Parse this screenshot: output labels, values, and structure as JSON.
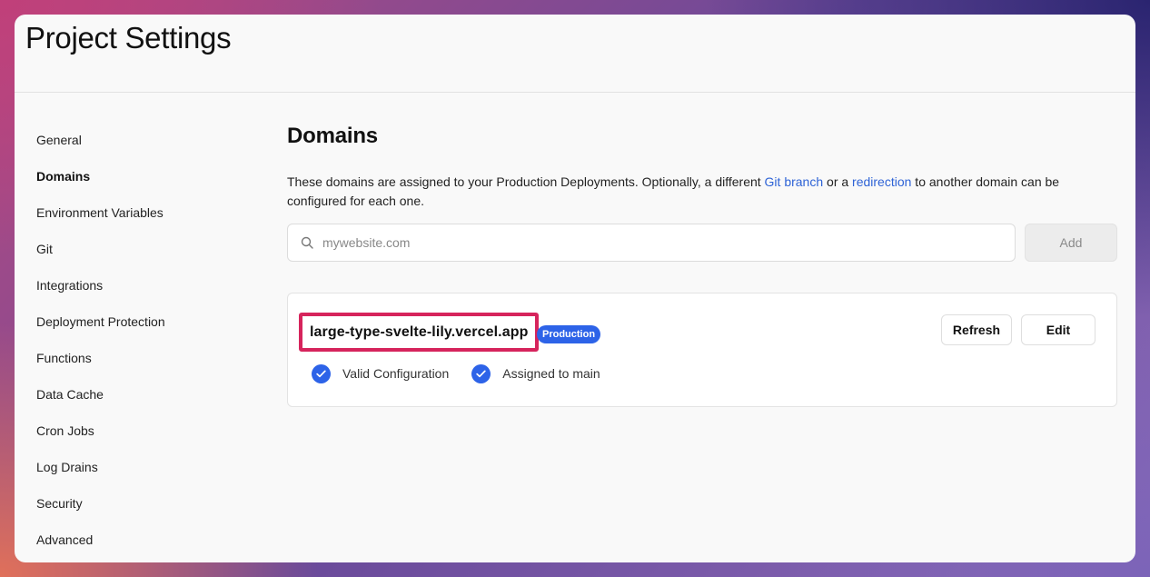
{
  "header": {
    "title": "Project Settings"
  },
  "sidebar": {
    "items": [
      {
        "label": "General"
      },
      {
        "label": "Domains"
      },
      {
        "label": "Environment Variables"
      },
      {
        "label": "Git"
      },
      {
        "label": "Integrations"
      },
      {
        "label": "Deployment Protection"
      },
      {
        "label": "Functions"
      },
      {
        "label": "Data Cache"
      },
      {
        "label": "Cron Jobs"
      },
      {
        "label": "Log Drains"
      },
      {
        "label": "Security"
      },
      {
        "label": "Advanced"
      }
    ],
    "active": "Domains"
  },
  "main": {
    "title": "Domains",
    "description": {
      "part1": "These domains are assigned to your Production Deployments. Optionally, a different ",
      "link1": "Git branch",
      "part2": " or a ",
      "link2": "redirection",
      "part3": " to another domain can be configured for each one."
    },
    "search": {
      "placeholder": "mywebsite.com",
      "value": ""
    },
    "add_label": "Add",
    "domain": {
      "name": "large-type-svelte-lily.vercel.app",
      "badge": "Production",
      "refresh_label": "Refresh",
      "edit_label": "Edit",
      "status1": "Valid Configuration",
      "status2": "Assigned to main"
    }
  },
  "colors": {
    "accent": "#2d63e8",
    "link": "#2e63d6",
    "highlight": "#d6245c"
  },
  "icons": {
    "search": "search-icon",
    "check": "check-circle-icon"
  }
}
